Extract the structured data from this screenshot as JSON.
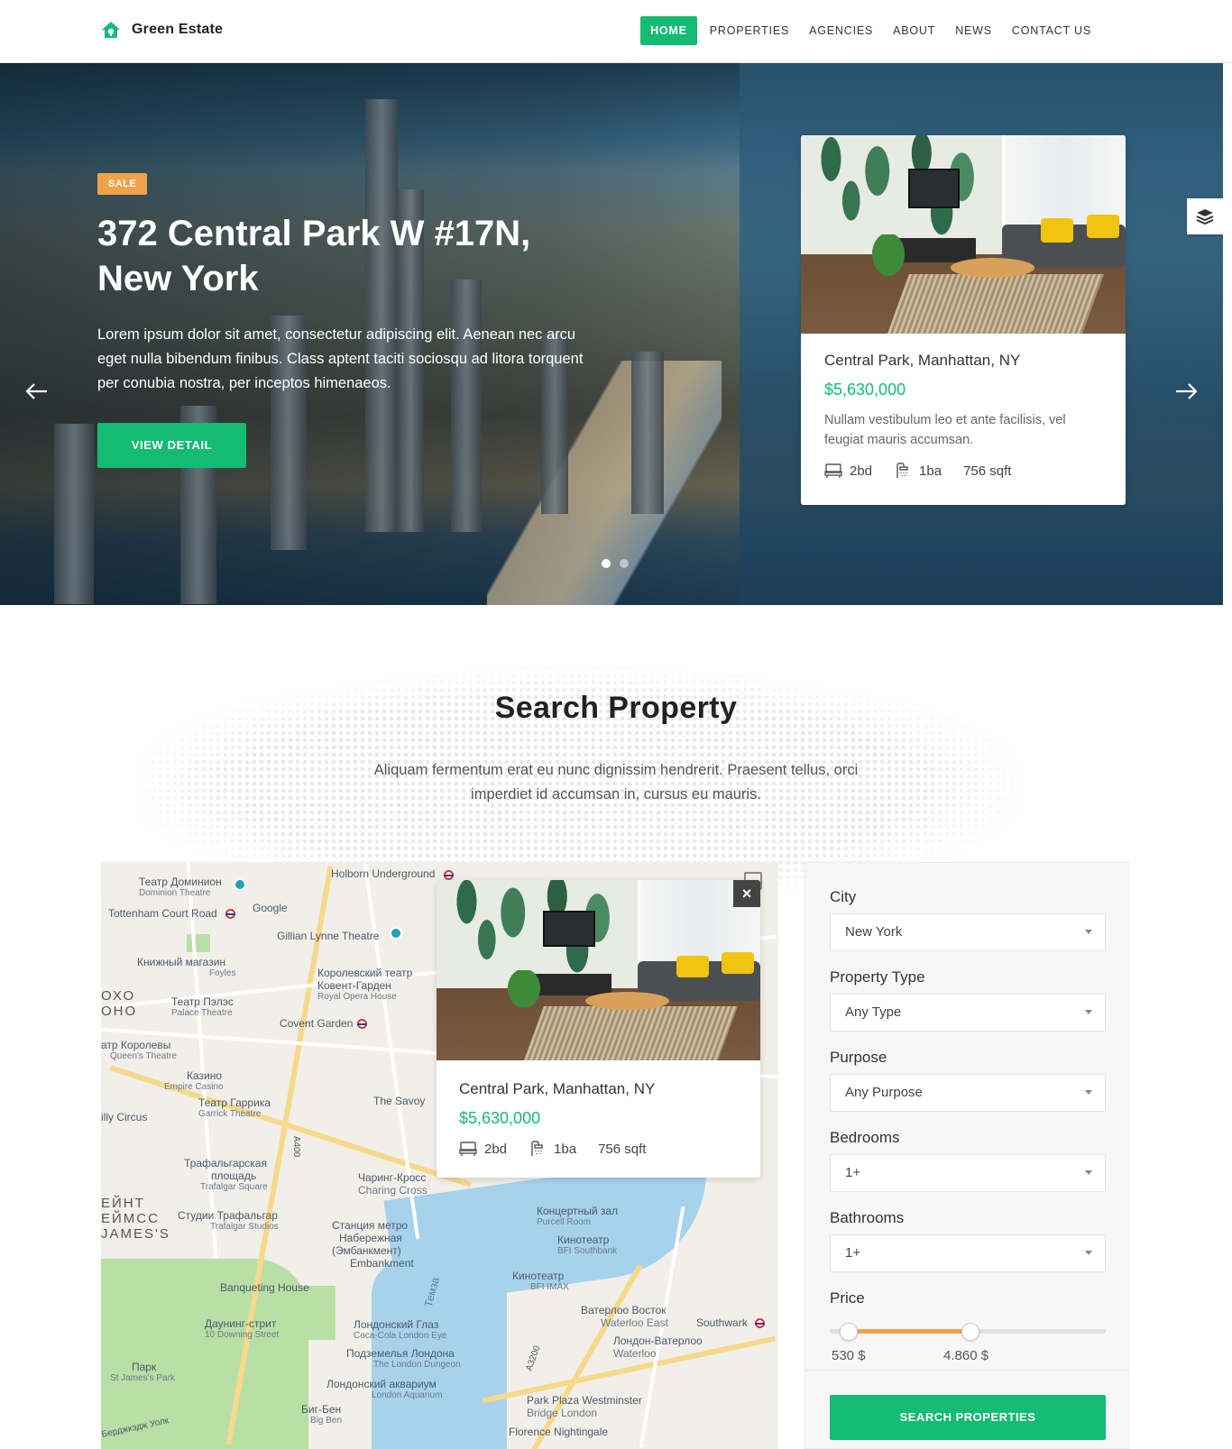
{
  "brand": {
    "name": "Green Estate",
    "color": "#13bb73"
  },
  "nav": {
    "items": [
      {
        "label": "HOME",
        "active": true
      },
      {
        "label": "PROPERTIES"
      },
      {
        "label": "AGENCIES"
      },
      {
        "label": "ABOUT"
      },
      {
        "label": "NEWS"
      },
      {
        "label": "CONTACT US"
      }
    ]
  },
  "hero": {
    "badge": "SALE",
    "title_line1": "372 Central Park W #17N,",
    "title_line2": "New York",
    "description": "Lorem ipsum dolor sit amet, consectetur adipiscing elit. Aenean nec arcu eget nulla bibendum finibus. Class aptent taciti sociosqu ad litora torquent per conubia nostra, per inceptos himenaeos.",
    "button": "VIEW DETAIL",
    "slide_count": 2,
    "active_slide": 1
  },
  "hero_card": {
    "title": "Central Park, Manhattan, NY",
    "price": "$5,630,000",
    "description": "Nullam vestibulum leo et ante facilisis, vel feugiat mauris accumsan.",
    "beds": "2bd",
    "baths": "1ba",
    "area": "756 sqft"
  },
  "search": {
    "title": "Search Property",
    "subtitle": "Aliquam fermentum erat eu nunc dignissim hendrerit. Praesent tellus, orci imperdiet id accumsan in, cursus eu mauris."
  },
  "map_popup": {
    "close": "×",
    "title": "Central Park, Manhattan, NY",
    "price": "$5,630,000",
    "beds": "2bd",
    "baths": "1ba",
    "area": "756 sqft"
  },
  "map_labels": {
    "l1": "Театр Доминион",
    "l1s": "Dominion Theatre",
    "l2": "Holborn Underground",
    "l3": "Tottenham Court Road",
    "l4": "Google",
    "l5": "Gillian Lynne Theatre",
    "l6": "Книжный магазин",
    "l6s": "Foyles",
    "l7": "Королевский театр",
    "l7b": "Ковент-Гарден",
    "l7s": "Royal Opera House",
    "l8": "ОХО",
    "l8b": "ОНО",
    "l9": "Театр Пэлэс",
    "l9s": "Palace Theatre",
    "l10": "Covent Garden",
    "l11": "атр Королевы",
    "l11s": "Queen's Theatre",
    "l12": "Казино",
    "l12s": "Empire Casino",
    "l13": "Театр Гаррика",
    "l13s": "Garrick Theatre",
    "l14": "The Savoy",
    "l15": "illy Circus",
    "l16": "Трафальгарская",
    "l16b": "площадь",
    "l16s": "Trafalgar Square",
    "l17": "Чаринг-Кросс",
    "l17s": "Charing Cross",
    "l18": "ЕЙНТ",
    "l18b": "ЕЙМСС",
    "l18c": "JAMES'S",
    "l19": "Студии Трафальгар",
    "l19s": "Trafalgar Studios",
    "l20": "Станция метро",
    "l20b": "Набережная",
    "l20c": "(Эмбанкмент)",
    "l20s": "Embankment",
    "l21": "Концертный зал",
    "l21s": "Purcell Room",
    "l22": "Кинотеатр",
    "l22s": "BFI Southbank",
    "l23": "Кинотеатр",
    "l23s": "BFI IMAX",
    "l24": "Banqueting House",
    "l25": "Даунинг-стрит",
    "l25s": "10 Downing Street",
    "l26": "Лондонский Глаз",
    "l26s": "Coca-Cola London Eye",
    "l27": "Ватерлоо Восток",
    "l27s": "Waterloo East",
    "l28": "Southwark",
    "l29": "Лондон-Ватерлоо",
    "l29s": "Waterloo",
    "l30": "Подземелья Лондона",
    "l30s": "The London Dungeon",
    "l31": "Парк",
    "l31s": "St James's Park",
    "l32": "Лондонский аквариум",
    "l32s": "London Aquarium",
    "l33": "Биг-Бен",
    "l33s": "Big Ben",
    "l34": "Park Plaza Westminster",
    "l34s": "Bridge London",
    "l35": "Florence Nightingale",
    "l36": "Темза",
    "l37": "A400",
    "l38": "A3200",
    "l39": "Берджкэдж Уолк"
  },
  "filter": {
    "city": {
      "label": "City",
      "value": "New York"
    },
    "property_type": {
      "label": "Property Type",
      "value": "Any Type"
    },
    "purpose": {
      "label": "Purpose",
      "value": "Any Purpose"
    },
    "bedrooms": {
      "label": "Bedrooms",
      "value": "1+"
    },
    "bathrooms": {
      "label": "Bathrooms",
      "value": "1+"
    },
    "price": {
      "label": "Price",
      "min_label": "530 $",
      "max_label": "4.860 $",
      "range_low_fraction": 0.07,
      "range_high_fraction": 0.51
    },
    "button": "SEARCH PROPERTIES"
  },
  "colors": {
    "accent": "#13bb73",
    "badge": "#f0a24a",
    "slider_fill": "#f0a24a"
  },
  "icons": [
    "home-logo-icon",
    "arrow-left-icon",
    "arrow-right-icon",
    "layers-icon",
    "bed-icon",
    "bath-icon",
    "close-icon",
    "fullscreen-icon",
    "caret-down-icon"
  ]
}
